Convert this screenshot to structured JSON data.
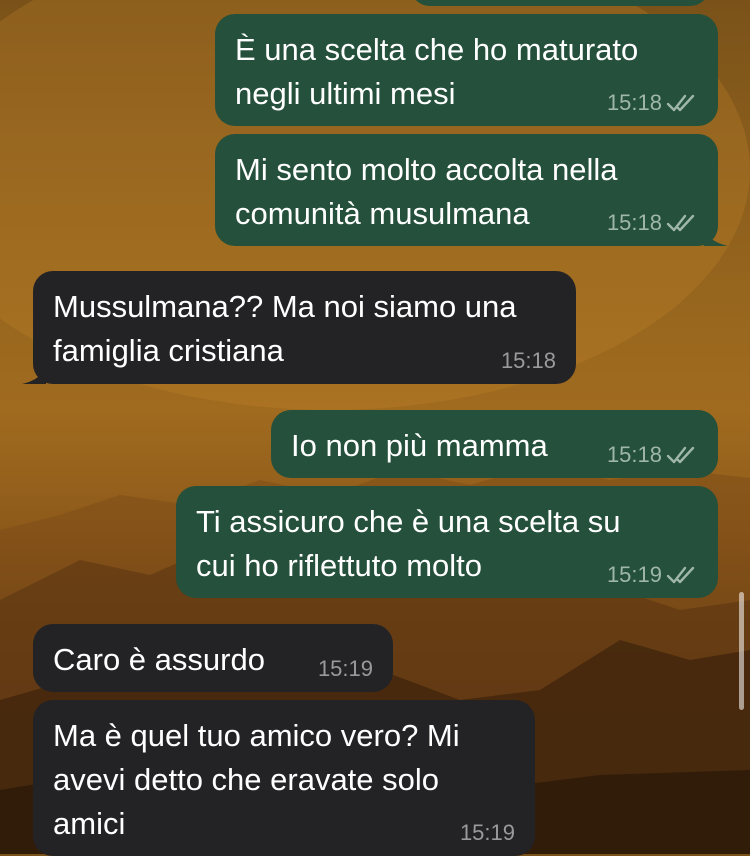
{
  "messages": [
    {
      "direction": "outgoing",
      "text": "È una scelta che ho maturato\nnegli ultimi mesi",
      "time": "15:18",
      "status": "double-check"
    },
    {
      "direction": "outgoing",
      "text": "Mi sento molto accolta nella\ncomunità musulmana",
      "time": "15:18",
      "status": "double-check"
    },
    {
      "direction": "incoming",
      "text": "Mussulmana?? Ma noi siamo una\nfamiglia cristiana",
      "time": "15:18"
    },
    {
      "direction": "outgoing",
      "text": "Io non più mamma",
      "time": "15:18",
      "status": "double-check"
    },
    {
      "direction": "outgoing",
      "text": "Ti assicuro che è una scelta su\ncui ho riflettuto molto",
      "time": "15:19",
      "status": "double-check"
    },
    {
      "direction": "incoming",
      "text": "Caro è assurdo",
      "time": "15:19"
    },
    {
      "direction": "incoming",
      "text": "Ma è quel tuo amico vero? Mi\navevi detto che eravate solo\namici",
      "time": "15:19"
    }
  ],
  "colors": {
    "outgoing_bubble": "#25503b",
    "incoming_bubble": "#232326",
    "text": "#ffffff"
  }
}
